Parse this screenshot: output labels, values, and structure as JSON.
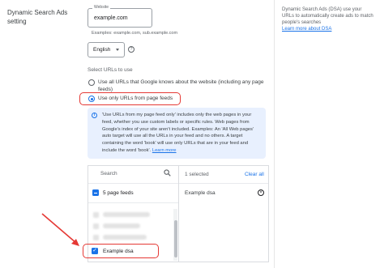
{
  "section": {
    "title": "Dynamic Search Ads setting"
  },
  "website": {
    "label": "Website",
    "value": "example.com",
    "examples": "Examples: example.com, sub.example.com"
  },
  "language": {
    "selected": "English"
  },
  "urls": {
    "heading": "Select URLs to use",
    "options": [
      {
        "label": "Use all URLs that Google knows about the website (including any page feeds)",
        "selected": false
      },
      {
        "label": "Use only URLs from page feeds",
        "selected": true
      }
    ]
  },
  "info": {
    "text": "'Use URLs from my page feed only' includes only the web pages in your feed, whether you use custom labels or specific rules. Web pages from Google's index of your site aren't included. Examples: An 'All Web pages' auto target will use all the URLs in your feed and no others. A target containing the word 'book' will use only URLs that are in your feed and include the word 'book'.",
    "link": "Learn more"
  },
  "picker": {
    "search_label": "Search",
    "feeds_label": "5 page feeds",
    "selected_item": "Example dsa",
    "selected_count": "1 selected",
    "clear_all": "Clear all",
    "right_items": [
      "Example dsa"
    ]
  },
  "help": {
    "text": "Dynamic Search Ads (DSA) use your URLs to automatically create ads to match people's searches",
    "link": "Learn more about DSA"
  },
  "colors": {
    "accent": "#1a73e8",
    "highlight": "#e53935",
    "info_bg": "#e8f0fe"
  }
}
